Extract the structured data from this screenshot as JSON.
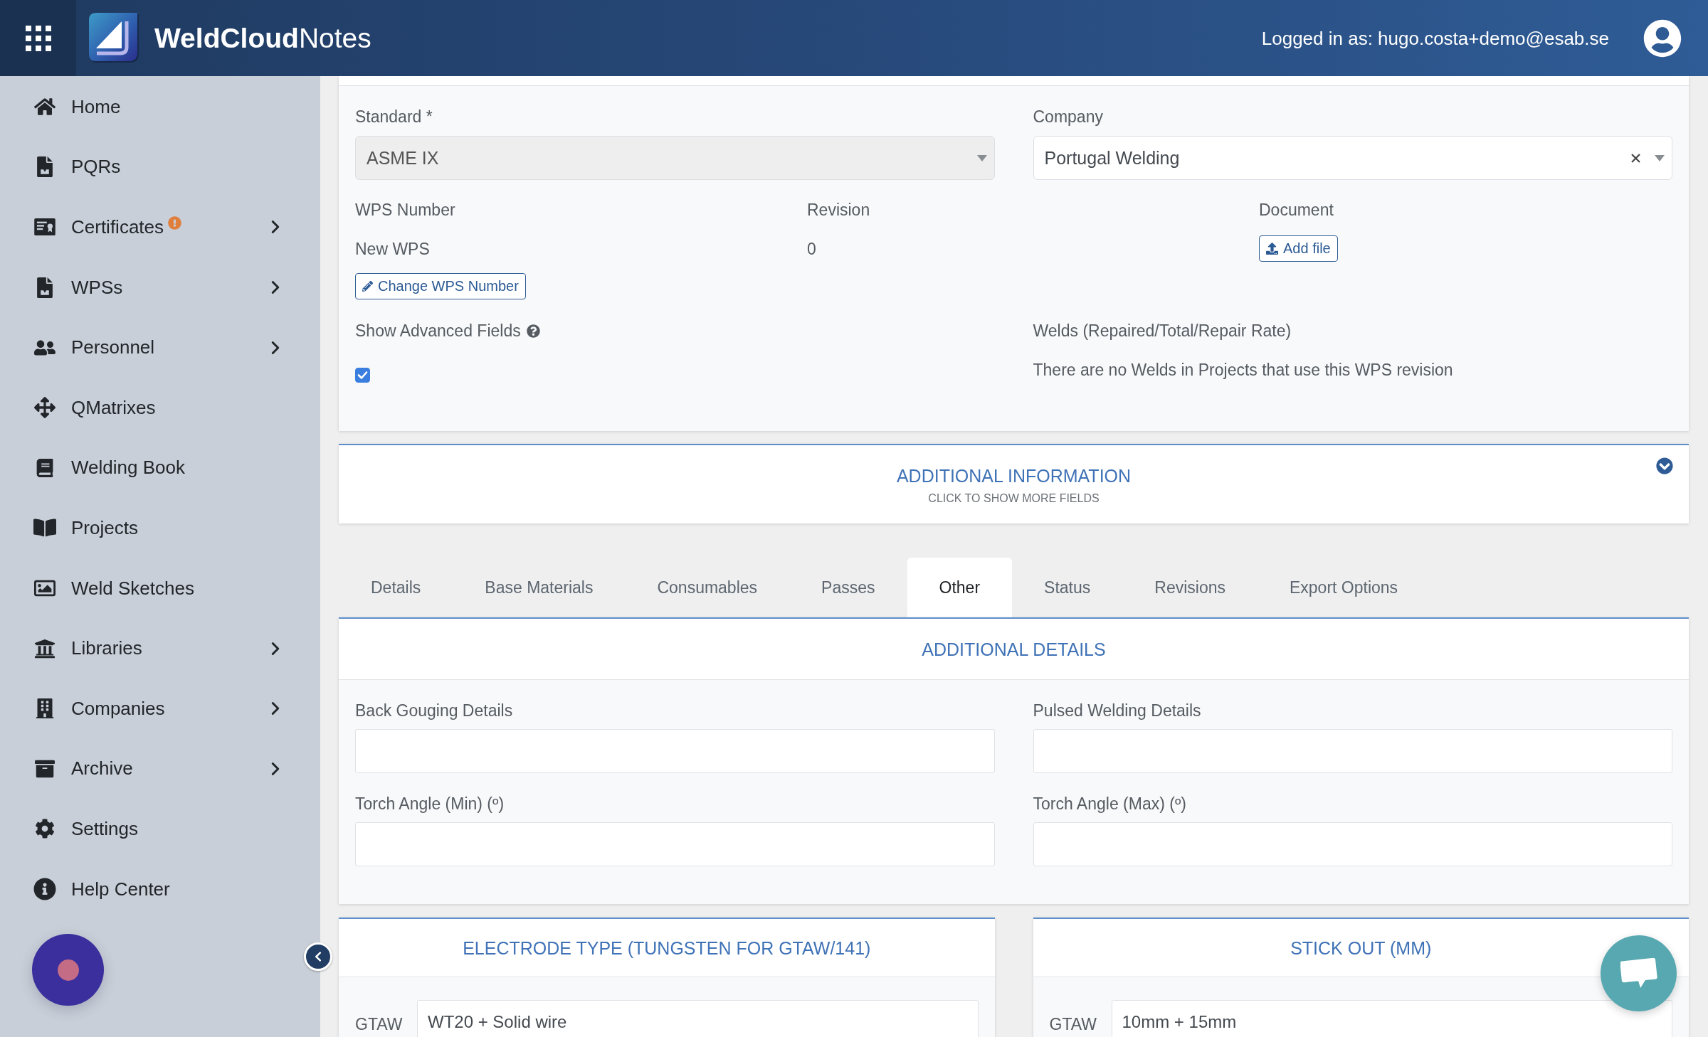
{
  "header": {
    "title": "**WeldCloud**Notes",
    "user": "Logged in as: hugo.costa+demo@esab.se"
  },
  "sidebar": {
    "items": [
      {
        "label": "Home",
        "has_submenu": false,
        "alert": false
      },
      {
        "label": "PQRs",
        "has_submenu": false,
        "alert": false
      },
      {
        "label": "Certificates",
        "has_submenu": true,
        "alert": true
      },
      {
        "label": "WPSs",
        "has_submenu": true,
        "alert": false
      },
      {
        "label": "Personnel",
        "has_submenu": true,
        "alert": false
      },
      {
        "label": "QMatrixes",
        "has_submenu": false,
        "alert": false
      },
      {
        "label": "Welding Book",
        "has_submenu": false,
        "alert": false
      },
      {
        "label": "Projects",
        "has_submenu": false,
        "alert": false
      },
      {
        "label": "Weld Sketches",
        "has_submenu": false,
        "alert": false
      },
      {
        "label": "Libraries",
        "has_submenu": true,
        "alert": false
      },
      {
        "label": "Companies",
        "has_submenu": true,
        "alert": false
      },
      {
        "label": "Archive",
        "has_submenu": true,
        "alert": false
      },
      {
        "label": "Settings",
        "has_submenu": false,
        "alert": false
      },
      {
        "label": "Help Center",
        "has_submenu": false,
        "alert": false
      }
    ]
  },
  "form": {
    "standard": {
      "label": "Standard *",
      "value": "ASME IX",
      "disabled": true
    },
    "company": {
      "label": "Company",
      "value": "Portugal Welding"
    },
    "wps_number": {
      "label": "WPS Number",
      "value": "New WPS",
      "button": "Change WPS Number"
    },
    "revision": {
      "label": "Revision",
      "value": "0"
    },
    "document": {
      "label": "Document",
      "button": "Add file"
    },
    "advanced_fields": {
      "label": "Show Advanced Fields",
      "checked": true
    },
    "welds": {
      "label": "Welds (Repaired/Total/Repair Rate)",
      "value": "There are no Welds in Projects that use this WPS revision"
    }
  },
  "additional_information": {
    "title": "ADDITIONAL INFORMATION",
    "subtitle": "CLICK TO SHOW MORE FIELDS",
    "expanded": false
  },
  "tabs": [
    {
      "label": "Details",
      "selected": false
    },
    {
      "label": "Base Materials",
      "selected": false
    },
    {
      "label": "Consumables",
      "selected": false
    },
    {
      "label": "Passes",
      "selected": false
    },
    {
      "label": "Other",
      "selected": true
    },
    {
      "label": "Status",
      "selected": false
    },
    {
      "label": "Revisions",
      "selected": false
    },
    {
      "label": "Export Options",
      "selected": false
    }
  ],
  "tab_panel": {
    "title": "ADDITIONAL DETAILS",
    "fields": [
      {
        "label": "Back Gouging Details"
      },
      {
        "label": "Pulsed Welding Details"
      },
      {
        "label": "Torch Angle (Min) (º)"
      },
      {
        "label": "Torch Angle (Max) (º)"
      }
    ]
  },
  "cards": [
    {
      "title": "ELECTRODE TYPE (TUNGSTEN FOR GTAW/141)",
      "rows": [
        {
          "label": "GTAW",
          "value": "WT20 + Solid wire"
        }
      ]
    },
    {
      "title": "STICK OUT (MM)",
      "rows": [
        {
          "label": "GTAW",
          "value": "10mm + 15mm"
        }
      ]
    }
  ]
}
